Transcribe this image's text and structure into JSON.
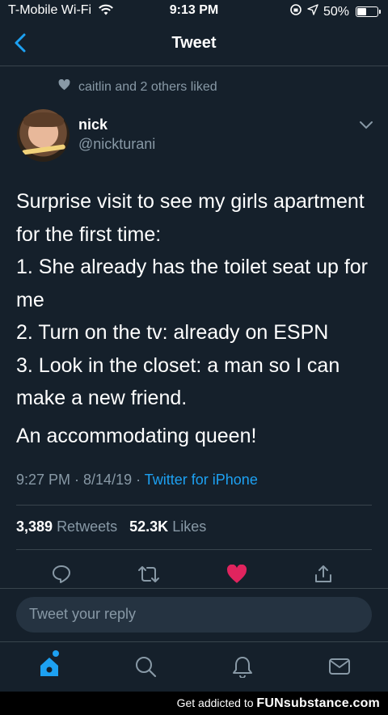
{
  "status_bar": {
    "carrier": "T-Mobile Wi-Fi",
    "time": "9:13 PM",
    "battery": "50%",
    "battery_level": 0.5
  },
  "nav": {
    "title": "Tweet",
    "back_icon": "chevron-left-icon"
  },
  "liked": {
    "text": "caitlin and 2 others liked",
    "icon": "heart-icon"
  },
  "tweet": {
    "author_name": "nick",
    "author_handle": "@nickturani",
    "lines": [
      "Surprise visit to see my girls apartment",
      "for the first time:",
      "1. She already has the toilet seat up for",
      "me",
      "2. Turn on the tv: already on ESPN",
      "3. Look in the closet: a man so I can",
      "make a new friend."
    ],
    "closing": "An accommodating queen!",
    "timestamp": "9:27 PM · 8/14/19 · ",
    "source": "Twitter for iPhone",
    "retweets_count": "3,389",
    "retweets_label": "Retweets",
    "likes_count": "52.3K",
    "likes_label": "Likes"
  },
  "actions": [
    "reply-icon",
    "retweet-icon",
    "like-icon",
    "share-icon"
  ],
  "reply": {
    "placeholder": "Tweet your reply"
  },
  "tabs": [
    "home-icon",
    "search-icon",
    "notifications-icon",
    "messages-icon"
  ],
  "watermark": {
    "prefix": "Get addicted to ",
    "brand": "FUNsubstance.com"
  },
  "colors": {
    "background": "#15202b",
    "accent": "#1da1f2",
    "like": "#e0245e",
    "secondary_text": "#8899a6"
  }
}
